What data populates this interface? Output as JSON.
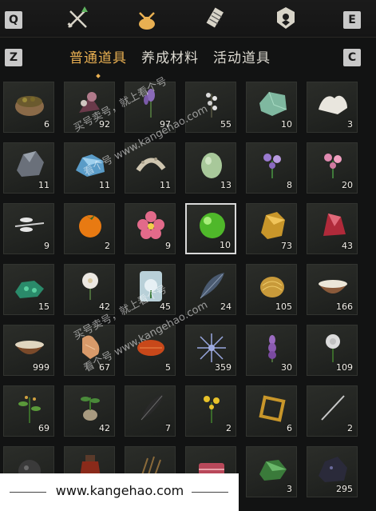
{
  "keys": {
    "left": "Q",
    "right": "E",
    "prev": "Z",
    "next": "C"
  },
  "categories": [
    {
      "icon": "crossed-swords-icon"
    },
    {
      "icon": "pouch-icon",
      "active": true
    },
    {
      "icon": "scroll-icon"
    },
    {
      "icon": "emblem-icon"
    }
  ],
  "tabs": [
    {
      "label": "普通道具",
      "active": true
    },
    {
      "label": "养成材料"
    },
    {
      "label": "活动道具"
    }
  ],
  "items": [
    {
      "icon": "mortar-herbs-icon",
      "count": "6"
    },
    {
      "icon": "dried-flowers-icon",
      "count": "92"
    },
    {
      "icon": "lavender-icon",
      "count": "97"
    },
    {
      "icon": "white-blossom-icon",
      "count": "55"
    },
    {
      "icon": "jade-stone-icon",
      "count": "10"
    },
    {
      "icon": "white-coral-icon",
      "count": "3"
    },
    {
      "icon": "dark-ore-icon",
      "count": "11"
    },
    {
      "icon": "blue-crystal-icon",
      "count": "11"
    },
    {
      "icon": "bone-icon",
      "count": "11"
    },
    {
      "icon": "green-egg-icon",
      "count": "13"
    },
    {
      "icon": "purple-flower-icon",
      "count": "8"
    },
    {
      "icon": "pink-flower-icon",
      "count": "20"
    },
    {
      "icon": "dragonfly-icon",
      "count": "9"
    },
    {
      "icon": "persimmon-icon",
      "count": "2"
    },
    {
      "icon": "pink-blossom-icon",
      "count": "9"
    },
    {
      "icon": "green-orb-icon",
      "count": "10",
      "selected": true
    },
    {
      "icon": "gold-ore-icon",
      "count": "73"
    },
    {
      "icon": "red-crystal-icon",
      "count": "43"
    },
    {
      "icon": "green-ore-icon",
      "count": "15"
    },
    {
      "icon": "white-lily-icon",
      "count": "42"
    },
    {
      "icon": "ice-flower-icon",
      "count": "45"
    },
    {
      "icon": "feather-icon",
      "count": "24"
    },
    {
      "icon": "gold-nugget-icon",
      "count": "105"
    },
    {
      "icon": "bowl-milk-icon",
      "count": "166"
    },
    {
      "icon": "bowl-rice-icon",
      "count": "999"
    },
    {
      "icon": "ginseng-icon",
      "count": "67"
    },
    {
      "icon": "red-shell-icon",
      "count": "5"
    },
    {
      "icon": "blue-spiky-flower-icon",
      "count": "359"
    },
    {
      "icon": "purple-spike-icon",
      "count": "30"
    },
    {
      "icon": "white-rose-icon",
      "count": "109"
    },
    {
      "icon": "green-herb-icon",
      "count": "69"
    },
    {
      "icon": "root-plant-icon",
      "count": "42"
    },
    {
      "icon": "black-quill-icon",
      "count": "7"
    },
    {
      "icon": "yellow-flower-icon",
      "count": "2"
    },
    {
      "icon": "golden-frame-icon",
      "count": "6"
    },
    {
      "icon": "needle-icon",
      "count": "2"
    },
    {
      "icon": "iron-ball-icon",
      "count": ""
    },
    {
      "icon": "wine-jar-icon",
      "count": ""
    },
    {
      "icon": "dry-grass-icon",
      "count": ""
    },
    {
      "icon": "meat-icon",
      "count": ""
    },
    {
      "icon": "green-stone-icon",
      "count": "3"
    },
    {
      "icon": "black-rock-icon",
      "count": "295"
    }
  ],
  "watermarks": [
    {
      "text": "买号卖号，就上看个号"
    },
    {
      "text": "看个号 www.kangehao.com"
    },
    {
      "text": "买号卖号，就上看个号"
    },
    {
      "text": "看个号 www.kangehao.com"
    }
  ],
  "banner": {
    "url": "www.kangehao.com"
  },
  "colors": {
    "accent": "#e9b052",
    "background": "#121313",
    "cell": "#262825"
  }
}
